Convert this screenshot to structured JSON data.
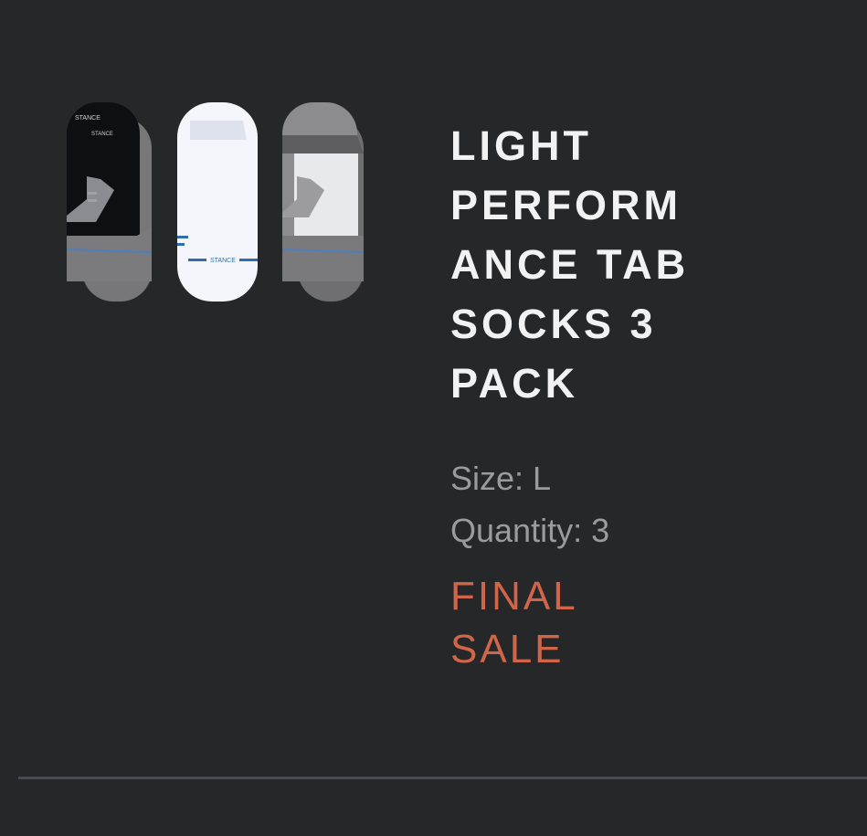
{
  "product": {
    "title_lines": [
      "LIGHT",
      "PERFORM",
      "ANCE TAB",
      "SOCKS 3",
      "PACK"
    ],
    "size": "Size: L",
    "quantity": "Quantity: 3",
    "sale_lines": [
      "FINAL",
      "SALE"
    ],
    "image": "three-ankle-socks-black-white-grey",
    "sock_brand_print": "STANCE"
  },
  "colors": {
    "background": "#262729",
    "title": "#f2f2f2",
    "meta": "#9a9b9e",
    "final_sale": "#d0654a",
    "divider": "#4a4b50"
  }
}
